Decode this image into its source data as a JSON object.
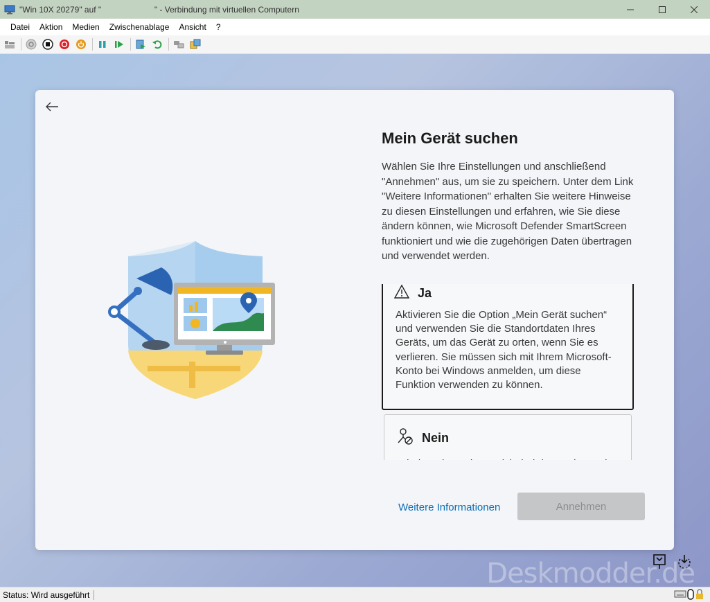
{
  "window": {
    "title": "\"Win 10X 20279\" auf \"                       \" - Verbindung mit virtuellen Computern"
  },
  "menu": {
    "items": [
      "Datei",
      "Aktion",
      "Medien",
      "Zwischenablage",
      "Ansicht",
      "?"
    ]
  },
  "toolbar": {
    "icons": [
      "ctrl-alt-del-icon",
      "start-icon",
      "stop-icon",
      "shutdown-icon",
      "power-icon",
      "pause-icon",
      "resume-icon",
      "checkpoint-icon",
      "revert-icon",
      "enhanced-session-icon",
      "share-icon"
    ]
  },
  "oobe": {
    "title": "Mein Gerät suchen",
    "description": "Wählen Sie Ihre Einstellungen und anschließend \"Annehmen\" aus, um sie zu speichern. Unter dem Link \"Weitere Informationen\" erhalten Sie weitere Hinweise zu diesen Einstellungen und erfahren, wie Sie diese ändern können, wie Microsoft Defender SmartScreen funktioniert und wie die zugehörigen Daten übertragen und verwendet werden.",
    "options": [
      {
        "title": "Ja",
        "description": "Aktivieren Sie die Option „Mein Gerät suchen“ und verwenden Sie die Standortdaten Ihres Geräts, um das Gerät zu orten, wenn Sie es verlieren. Sie müssen sich mit Ihrem Microsoft-Konto bei Windows anmelden, um diese Funktion verwenden zu können."
      },
      {
        "title": "Nein",
        "description": "Windows kann Ihnen nicht bei der Suche nach Ihrem Gerät helfen."
      }
    ],
    "more_info": "Weitere Informationen",
    "accept": "Annehmen"
  },
  "watermark": "Deskmodder.de",
  "status": {
    "text": "Status: Wird ausgeführt"
  },
  "colors": {
    "accent_link": "#0a6db5",
    "titlebar": "#c3d3c1"
  }
}
